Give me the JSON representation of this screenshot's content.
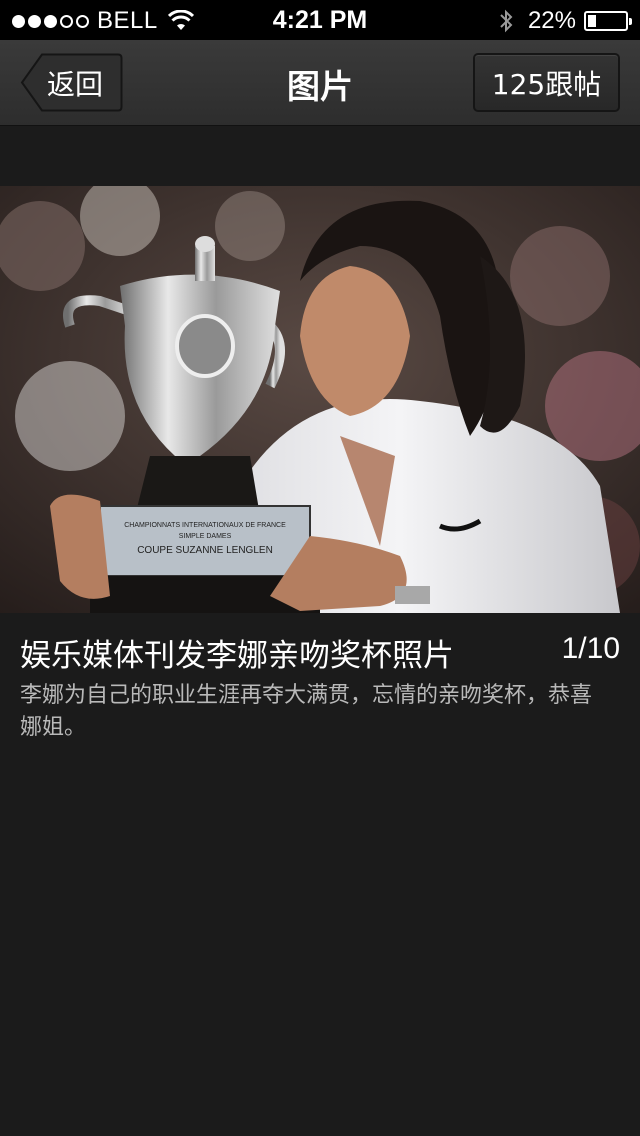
{
  "status_bar": {
    "carrier": "BELL",
    "time": "4:21 PM",
    "battery_percent": "22%",
    "battery_level": 0.22,
    "signal_bars_filled": 3,
    "signal_bars_total": 5
  },
  "nav": {
    "back_label": "返回",
    "title": "图片",
    "reply_label": "125跟帖"
  },
  "photo": {
    "trophy_plaque_line1": "CHAMPIONNATS INTERNATIONAUX DE FRANCE",
    "trophy_plaque_line2": "SIMPLE DAMES",
    "trophy_plaque_line3": "COUPE SUZANNE LENGLEN"
  },
  "caption": {
    "title": "娱乐媒体刊发李娜亲吻奖杯照片",
    "counter": "1/10",
    "description": "李娜为自己的职业生涯再夺大满贯，忘情的亲吻奖杯，恭喜娜姐。"
  },
  "colors": {
    "background": "#1b1b1b",
    "nav_bar": "#333333",
    "status_bar": "#000000",
    "caption_secondary": "#b9b9b9"
  }
}
